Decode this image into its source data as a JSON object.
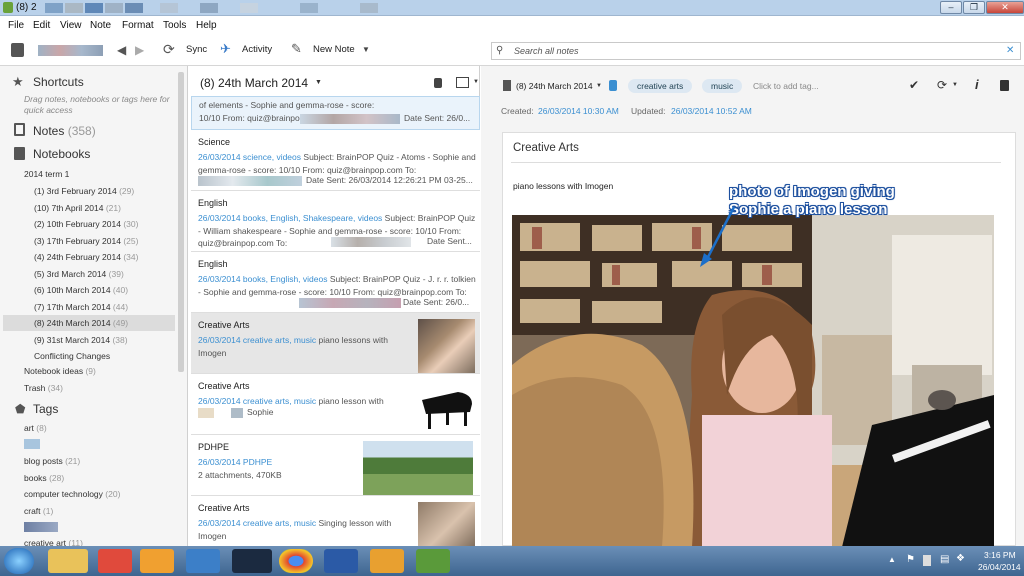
{
  "window": {
    "title": "(8) 2"
  },
  "menu": [
    "File",
    "Edit",
    "View",
    "Note",
    "Format",
    "Tools",
    "Help"
  ],
  "toolbar": {
    "sync": "Sync",
    "activity": "Activity",
    "new_note": "New Note",
    "search_placeholder": "Search all notes"
  },
  "sidebar": {
    "shortcuts": "Shortcuts",
    "shortcuts_hint": "Drag notes, notebooks or tags here for quick access",
    "notes": "Notes",
    "notes_count": "(358)",
    "notebooks": "Notebooks",
    "stack": "2014 term 1",
    "items": [
      {
        "label": "(1) 3rd February 2014",
        "count": "(29)"
      },
      {
        "label": "(10) 7th April 2014",
        "count": "(21)"
      },
      {
        "label": "(2) 10th February 2014",
        "count": "(30)"
      },
      {
        "label": "(3) 17th February 2014",
        "count": "(25)"
      },
      {
        "label": "(4) 24th February 2014",
        "count": "(34)"
      },
      {
        "label": "(5) 3rd March 2014",
        "count": "(39)"
      },
      {
        "label": "(6) 10th March 2014",
        "count": "(40)"
      },
      {
        "label": "(7) 17th March 2014",
        "count": "(44)"
      },
      {
        "label": "(8) 24th March 2014",
        "count": "(49)"
      },
      {
        "label": "(9) 31st March 2014",
        "count": "(38)"
      },
      {
        "label": "Conflicting Changes",
        "count": ""
      }
    ],
    "notebook_ideas": "Notebook ideas",
    "notebook_ideas_count": "(9)",
    "trash": "Trash",
    "trash_count": "(34)",
    "tags": "Tags",
    "tag_items": [
      {
        "label": "art",
        "count": "(8)"
      },
      {
        "label": "blog posts",
        "count": "(21)"
      },
      {
        "label": "books",
        "count": "(28)"
      },
      {
        "label": "computer technology",
        "count": "(20)"
      },
      {
        "label": "craft",
        "count": "(1)"
      },
      {
        "label": "creative art",
        "count": "(11)"
      }
    ]
  },
  "notelist": {
    "header": "(8) 24th March 2014",
    "notes": [
      {
        "title": "",
        "meta": "",
        "snippet": "of elements - Sophie and gemma-rose - score: 10/10 From: quiz@brainpop.com To:",
        "extra": "Date Sent: 26/0..."
      },
      {
        "title": "Science",
        "meta": "26/03/2014  science, videos",
        "snippet": "Subject: BrainPOP Quiz - Atoms - Sophie and gemma-rose - score: 10/10 From: quiz@brainpop.com To:",
        "extra": "Date Sent: 26/03/2014 12:26:21 PM 03-25..."
      },
      {
        "title": "English",
        "meta": "26/03/2014  books, English, Shakespeare, videos",
        "snippet": "Subject: BrainPOP Quiz - William shakespeare - Sophie and gemma-rose - score: 10/10 From: quiz@brainpop.com To:",
        "extra": "Date Sent..."
      },
      {
        "title": "English",
        "meta": "26/03/2014  books, English, videos",
        "snippet": "Subject: BrainPOP Quiz - J. r. r. tolkien - Sophie and gemma-rose - score: 10/10 From: quiz@brainpop.com To:",
        "extra": "Date Sent: 26/0..."
      },
      {
        "title": "Creative Arts",
        "meta": "26/03/2014  creative arts, music",
        "snippet": "piano lessons with Imogen",
        "extra": ""
      },
      {
        "title": "Creative Arts",
        "meta": "26/03/2014  creative arts, music",
        "snippet": "piano lesson with",
        "extra": "Sophie"
      },
      {
        "title": "PDHPE",
        "meta": "26/03/2014  PDHPE",
        "snippet": "2 attachments,  470KB",
        "extra": ""
      },
      {
        "title": "Creative Arts",
        "meta": "26/03/2014  creative arts, music",
        "snippet": "Singing lesson with Imogen",
        "extra": ""
      }
    ]
  },
  "detail": {
    "notebook": "(8) 24th March 2014",
    "tags": [
      "creative arts",
      "music"
    ],
    "add_tag": "Click to add tag...",
    "created_label": "Created:",
    "created": "26/03/2014 10:30 AM",
    "updated_label": "Updated:",
    "updated": "26/03/2014 10:52 AM",
    "note_title": "Creative Arts",
    "body": "piano lessons with Imogen",
    "annotation_line1": "photo of Imogen giving",
    "annotation_line2": "Sophie a piano lesson"
  },
  "taskbar": {
    "time": "3:16 PM",
    "date": "26/04/2014"
  }
}
